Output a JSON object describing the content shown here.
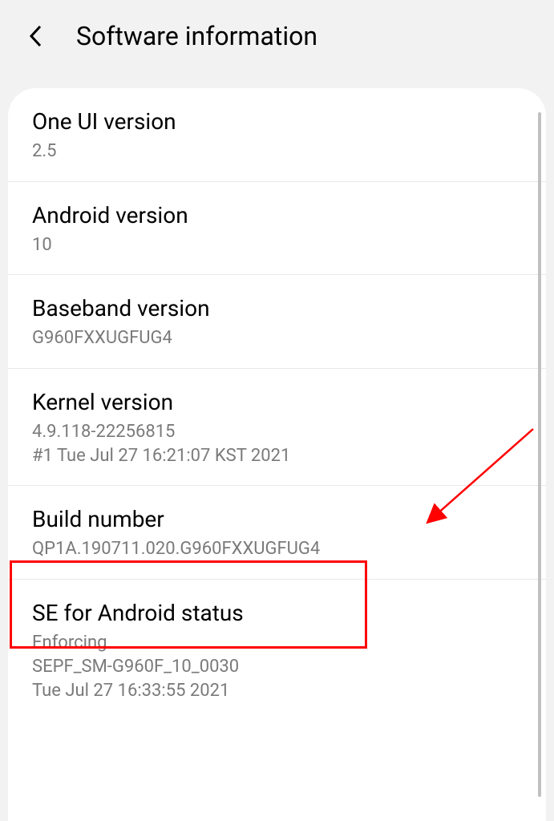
{
  "header": {
    "title": "Software information"
  },
  "items": [
    {
      "title": "One UI version",
      "value": "2.5"
    },
    {
      "title": "Android version",
      "value": "10"
    },
    {
      "title": "Baseband version",
      "value": "G960FXXUGFUG4"
    },
    {
      "title": "Kernel version",
      "value": "4.9.118-22256815\n#1 Tue Jul 27 16:21:07 KST 2021"
    },
    {
      "title": "Build number",
      "value": "QP1A.190711.020.G960FXXUGFUG4"
    },
    {
      "title": "SE for Android status",
      "value": "Enforcing\nSEPF_SM-G960F_10_0030\nTue Jul 27 16:33:55 2021"
    }
  ]
}
